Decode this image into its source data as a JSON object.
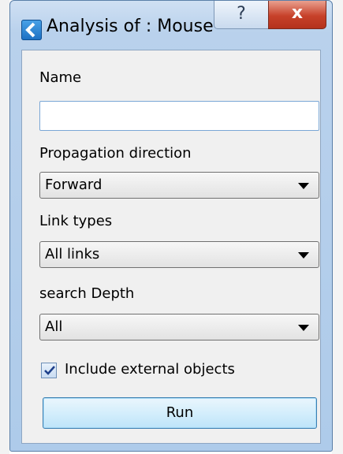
{
  "window": {
    "title": "Analysis of : Mouse",
    "help_label": "?",
    "close_label": "x"
  },
  "form": {
    "name_label": "Name",
    "name_value": "",
    "direction_label": "Propagation direction",
    "direction_value": "Forward",
    "link_types_label": "Link types",
    "link_types_value": "All links",
    "depth_label": "search Depth",
    "depth_value": "All",
    "include_external_label": "Include external objects",
    "include_external_checked": true,
    "run_label": "Run"
  },
  "colors": {
    "title_gradient": "#b9d1ec",
    "close_button": "#c7412a",
    "run_button": "#d4eefc"
  }
}
